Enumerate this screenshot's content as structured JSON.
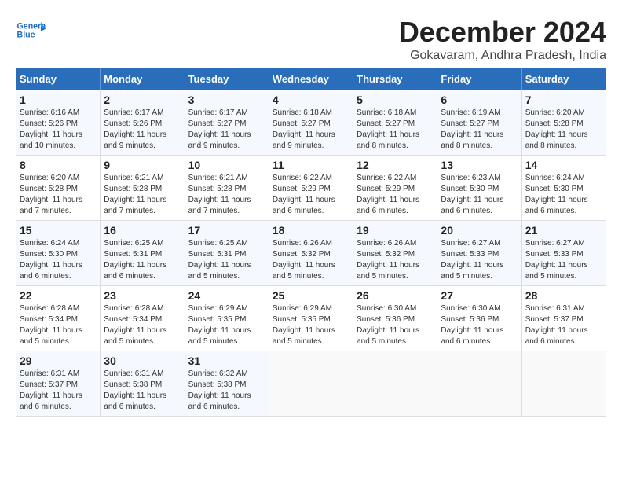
{
  "logo": {
    "line1": "General",
    "line2": "Blue"
  },
  "title": "December 2024",
  "location": "Gokavaram, Andhra Pradesh, India",
  "headers": [
    "Sunday",
    "Monday",
    "Tuesday",
    "Wednesday",
    "Thursday",
    "Friday",
    "Saturday"
  ],
  "weeks": [
    [
      {
        "day": "1",
        "sunrise": "6:16 AM",
        "sunset": "5:26 PM",
        "daylight": "11 hours and 10 minutes."
      },
      {
        "day": "2",
        "sunrise": "6:17 AM",
        "sunset": "5:26 PM",
        "daylight": "11 hours and 9 minutes."
      },
      {
        "day": "3",
        "sunrise": "6:17 AM",
        "sunset": "5:27 PM",
        "daylight": "11 hours and 9 minutes."
      },
      {
        "day": "4",
        "sunrise": "6:18 AM",
        "sunset": "5:27 PM",
        "daylight": "11 hours and 9 minutes."
      },
      {
        "day": "5",
        "sunrise": "6:18 AM",
        "sunset": "5:27 PM",
        "daylight": "11 hours and 8 minutes."
      },
      {
        "day": "6",
        "sunrise": "6:19 AM",
        "sunset": "5:27 PM",
        "daylight": "11 hours and 8 minutes."
      },
      {
        "day": "7",
        "sunrise": "6:20 AM",
        "sunset": "5:28 PM",
        "daylight": "11 hours and 8 minutes."
      }
    ],
    [
      {
        "day": "8",
        "sunrise": "6:20 AM",
        "sunset": "5:28 PM",
        "daylight": "11 hours and 7 minutes."
      },
      {
        "day": "9",
        "sunrise": "6:21 AM",
        "sunset": "5:28 PM",
        "daylight": "11 hours and 7 minutes."
      },
      {
        "day": "10",
        "sunrise": "6:21 AM",
        "sunset": "5:28 PM",
        "daylight": "11 hours and 7 minutes."
      },
      {
        "day": "11",
        "sunrise": "6:22 AM",
        "sunset": "5:29 PM",
        "daylight": "11 hours and 6 minutes."
      },
      {
        "day": "12",
        "sunrise": "6:22 AM",
        "sunset": "5:29 PM",
        "daylight": "11 hours and 6 minutes."
      },
      {
        "day": "13",
        "sunrise": "6:23 AM",
        "sunset": "5:30 PM",
        "daylight": "11 hours and 6 minutes."
      },
      {
        "day": "14",
        "sunrise": "6:24 AM",
        "sunset": "5:30 PM",
        "daylight": "11 hours and 6 minutes."
      }
    ],
    [
      {
        "day": "15",
        "sunrise": "6:24 AM",
        "sunset": "5:30 PM",
        "daylight": "11 hours and 6 minutes."
      },
      {
        "day": "16",
        "sunrise": "6:25 AM",
        "sunset": "5:31 PM",
        "daylight": "11 hours and 6 minutes."
      },
      {
        "day": "17",
        "sunrise": "6:25 AM",
        "sunset": "5:31 PM",
        "daylight": "11 hours and 5 minutes."
      },
      {
        "day": "18",
        "sunrise": "6:26 AM",
        "sunset": "5:32 PM",
        "daylight": "11 hours and 5 minutes."
      },
      {
        "day": "19",
        "sunrise": "6:26 AM",
        "sunset": "5:32 PM",
        "daylight": "11 hours and 5 minutes."
      },
      {
        "day": "20",
        "sunrise": "6:27 AM",
        "sunset": "5:33 PM",
        "daylight": "11 hours and 5 minutes."
      },
      {
        "day": "21",
        "sunrise": "6:27 AM",
        "sunset": "5:33 PM",
        "daylight": "11 hours and 5 minutes."
      }
    ],
    [
      {
        "day": "22",
        "sunrise": "6:28 AM",
        "sunset": "5:34 PM",
        "daylight": "11 hours and 5 minutes."
      },
      {
        "day": "23",
        "sunrise": "6:28 AM",
        "sunset": "5:34 PM",
        "daylight": "11 hours and 5 minutes."
      },
      {
        "day": "24",
        "sunrise": "6:29 AM",
        "sunset": "5:35 PM",
        "daylight": "11 hours and 5 minutes."
      },
      {
        "day": "25",
        "sunrise": "6:29 AM",
        "sunset": "5:35 PM",
        "daylight": "11 hours and 5 minutes."
      },
      {
        "day": "26",
        "sunrise": "6:30 AM",
        "sunset": "5:36 PM",
        "daylight": "11 hours and 5 minutes."
      },
      {
        "day": "27",
        "sunrise": "6:30 AM",
        "sunset": "5:36 PM",
        "daylight": "11 hours and 6 minutes."
      },
      {
        "day": "28",
        "sunrise": "6:31 AM",
        "sunset": "5:37 PM",
        "daylight": "11 hours and 6 minutes."
      }
    ],
    [
      {
        "day": "29",
        "sunrise": "6:31 AM",
        "sunset": "5:37 PM",
        "daylight": "11 hours and 6 minutes."
      },
      {
        "day": "30",
        "sunrise": "6:31 AM",
        "sunset": "5:38 PM",
        "daylight": "11 hours and 6 minutes."
      },
      {
        "day": "31",
        "sunrise": "6:32 AM",
        "sunset": "5:38 PM",
        "daylight": "11 hours and 6 minutes."
      },
      null,
      null,
      null,
      null
    ]
  ]
}
